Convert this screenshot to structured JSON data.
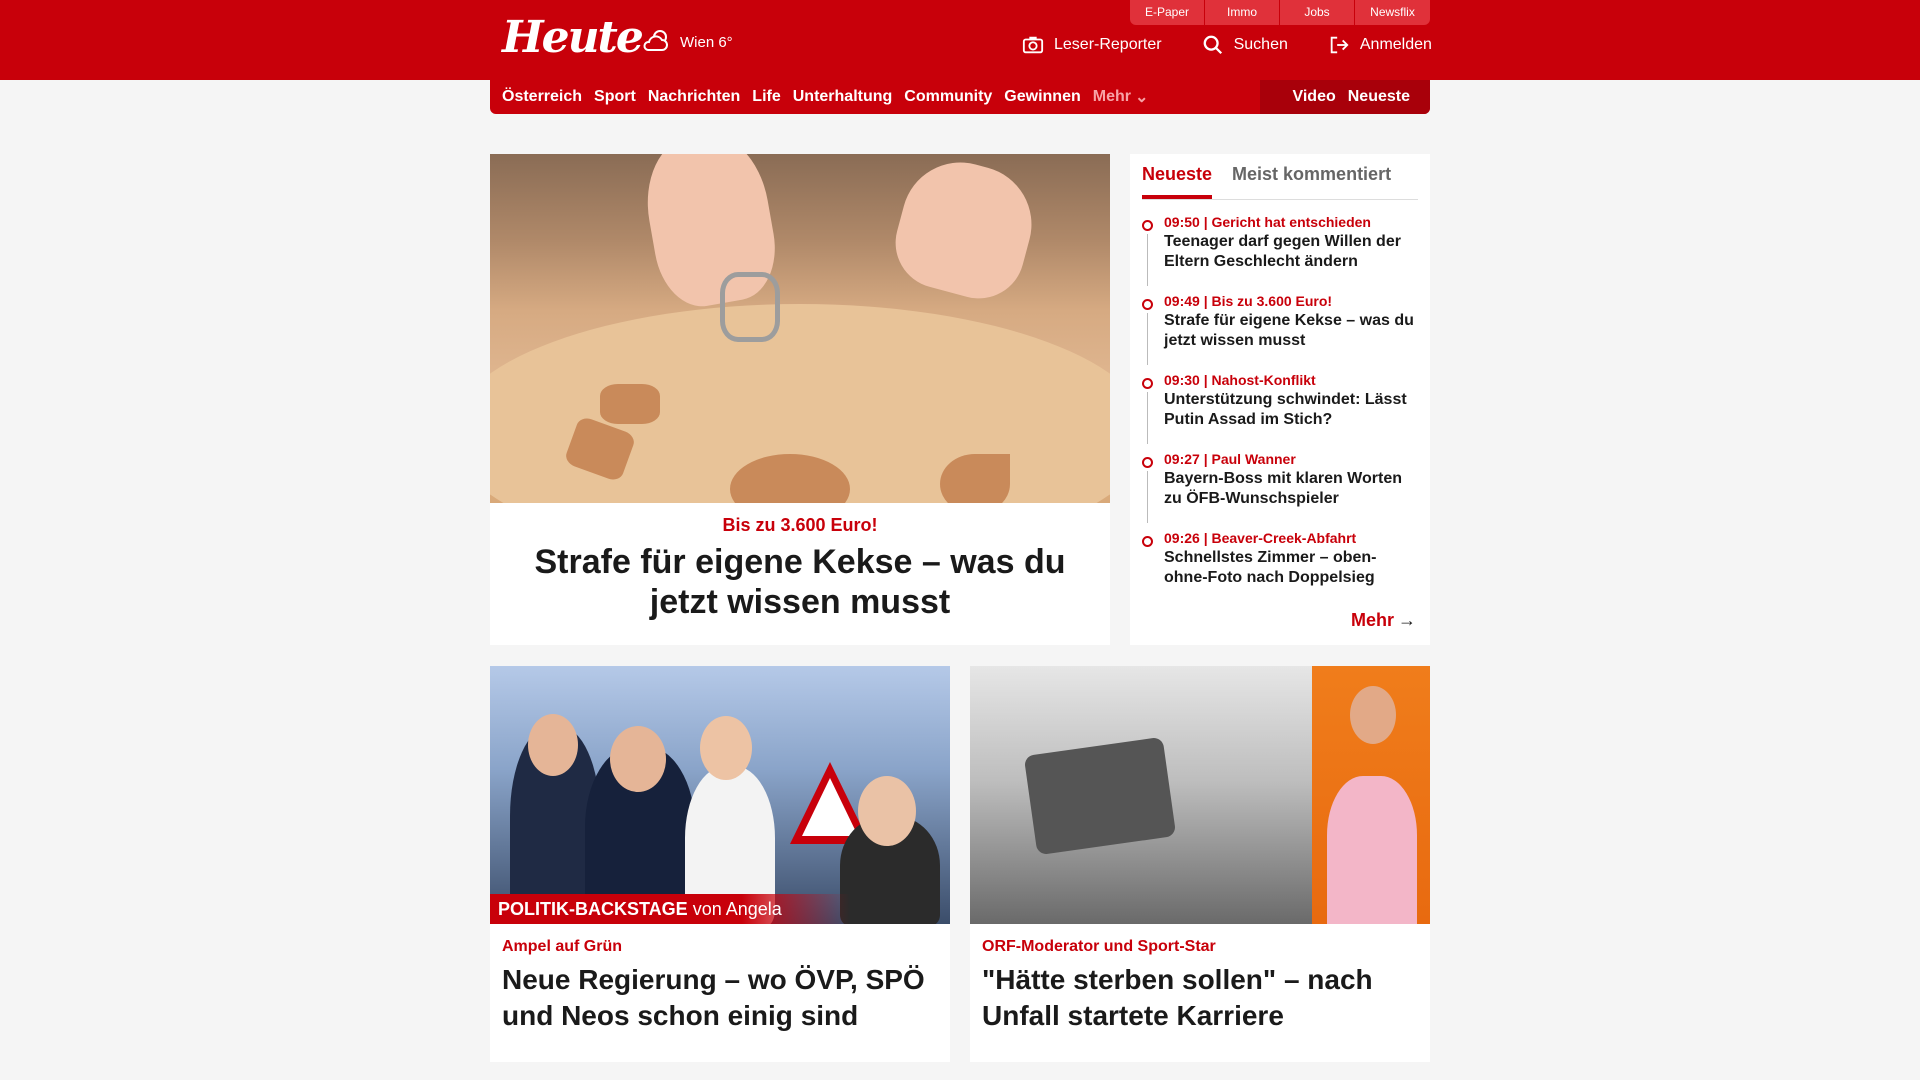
{
  "header": {
    "logo": "Heute",
    "weather": "Wien 6°",
    "util_links": [
      "E-Paper",
      "Immo",
      "Jobs",
      "Newsflix"
    ],
    "actions": {
      "reporter": "Leser-Reporter",
      "search": "Suchen",
      "login": "Anmelden"
    }
  },
  "nav": {
    "items": [
      "Österreich",
      "Sport",
      "Nachrichten",
      "Life",
      "Unterhaltung",
      "Community",
      "Gewinnen"
    ],
    "more": "Mehr",
    "video": "Video",
    "newest": "Neueste"
  },
  "hero": {
    "kicker": "Bis zu 3.600 Euro!",
    "title": "Strafe für eigene Kekse – was du jetzt wissen musst"
  },
  "sidebar": {
    "tabs": [
      "Neueste",
      "Meist kommentiert"
    ],
    "items": [
      {
        "kicker": "09:50 | Gericht hat entschieden",
        "title": "Teenager darf gegen Willen der Eltern Geschlecht ändern"
      },
      {
        "kicker": "09:49 | Bis zu 3.600 Euro!",
        "title": "Strafe für eigene Kekse – was du jetzt wissen musst"
      },
      {
        "kicker": "09:30 | Nahost-Konflikt",
        "title": "Unterstützung schwindet: Lässt Putin Assad im Stich?"
      },
      {
        "kicker": "09:27 | Paul Wanner",
        "title": "Bayern-Boss mit klaren Worten zu ÖFB-Wunschspieler"
      },
      {
        "kicker": "09:26 | Beaver-Creek-Abfahrt",
        "title": "Schnellstes Zimmer – oben-ohne-Foto nach Doppelsieg"
      }
    ],
    "more": "Mehr"
  },
  "cards": [
    {
      "ribbon": "POLITIK-BACKSTAGE",
      "ribbon_by": "von Angela Sellner",
      "kicker": "Ampel auf Grün",
      "title": "Neue Regierung – wo ÖVP, SPÖ und Neos schon einig sind"
    },
    {
      "kicker": "ORF-Moderator und Sport-Star",
      "title": "\"Hätte sterben sollen\" – nach Unfall startete Karriere"
    }
  ],
  "colors": {
    "brand": "#c8000a",
    "background": "#f5f5f5"
  }
}
